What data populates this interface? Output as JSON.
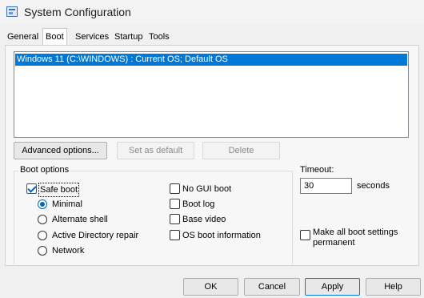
{
  "window": {
    "title": "System Configuration",
    "icon": "system-config-icon"
  },
  "tabs": [
    {
      "label": "General",
      "active": false
    },
    {
      "label": "Boot",
      "active": true
    },
    {
      "label": "Services",
      "active": false
    },
    {
      "label": "Startup",
      "active": false
    },
    {
      "label": "Tools",
      "active": false
    }
  ],
  "os_list": {
    "items": [
      "Windows 11 (C:\\WINDOWS) : Current OS; Default OS"
    ]
  },
  "buttons": {
    "advanced": "Advanced options...",
    "set_default": "Set as default",
    "delete": "Delete",
    "ok": "OK",
    "cancel": "Cancel",
    "apply": "Apply",
    "help": "Help"
  },
  "boot_options": {
    "legend": "Boot options",
    "safe_boot": {
      "label": "Safe boot",
      "checked": true
    },
    "radios": [
      {
        "label": "Minimal",
        "checked": true
      },
      {
        "label": "Alternate shell",
        "checked": false
      },
      {
        "label": "Active Directory repair",
        "checked": false
      },
      {
        "label": "Network",
        "checked": false
      }
    ],
    "right_checks": [
      {
        "label": "No GUI boot",
        "checked": false
      },
      {
        "label": "Boot log",
        "checked": false
      },
      {
        "label": "Base video",
        "checked": false
      },
      {
        "label": "OS boot information",
        "checked": false
      }
    ]
  },
  "timeout": {
    "label": "Timeout:",
    "value": "30",
    "unit": "seconds"
  },
  "make_permanent": {
    "label_line1": "Make all boot settings",
    "label_line2": "permanent",
    "checked": false
  },
  "colors": {
    "selection": "#0078d7",
    "accent": "#0067c0"
  }
}
